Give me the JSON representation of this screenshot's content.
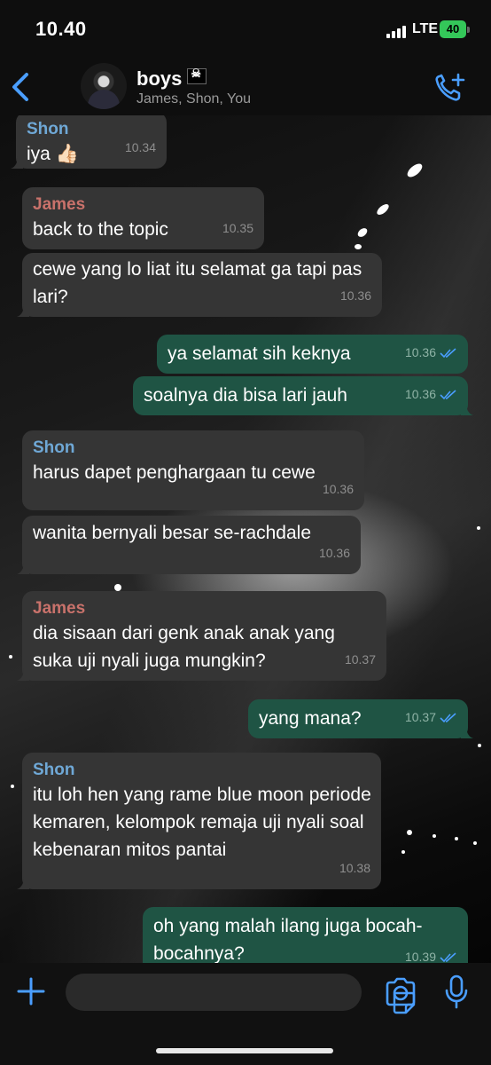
{
  "status_bar": {
    "time": "10.40",
    "network": "LTE",
    "battery": "40"
  },
  "header": {
    "back_icon": "chevron-left-icon",
    "title": "boys",
    "title_emoji": "pirate-flag",
    "subtitle": "James, Shon, You",
    "action_icon": "add-call-icon"
  },
  "colors": {
    "accent": "#4a9eff",
    "incoming": "#353535",
    "outgoing": "#1f5444",
    "shon": "#6fa8d6",
    "james": "#c9726b"
  },
  "messages": [
    {
      "sender": "Shon",
      "text": "iya 👍🏻",
      "time": "10.34",
      "direction": "in"
    },
    {
      "sender": "James",
      "text": "back to the topic",
      "time": "10.35",
      "direction": "in"
    },
    {
      "sender": "",
      "text": "cewe yang lo liat itu selamat ga tapi pas lari?",
      "time": "10.36",
      "direction": "in"
    },
    {
      "sender": "",
      "text": "ya selamat sih keknya",
      "time": "10.36",
      "direction": "out",
      "read": true
    },
    {
      "sender": "",
      "text": "soalnya dia bisa lari jauh",
      "time": "10.36",
      "direction": "out",
      "read": true
    },
    {
      "sender": "Shon",
      "text": "harus dapet penghargaan tu cewe",
      "time": "10.36",
      "direction": "in"
    },
    {
      "sender": "",
      "text": "wanita bernyali besar se-rachdale",
      "time": "10.36",
      "direction": "in"
    },
    {
      "sender": "James",
      "text": "dia sisaan dari genk anak anak yang suka uji nyali juga mungkin?",
      "time": "10.37",
      "direction": "in"
    },
    {
      "sender": "",
      "text": "yang mana?",
      "time": "10.37",
      "direction": "out",
      "read": true
    },
    {
      "sender": "Shon",
      "text": "itu loh hen yang rame blue moon periode kemaren, kelompok remaja uji nyali soal kebenaran mitos pantai",
      "time": "10.38",
      "direction": "in"
    },
    {
      "sender": "",
      "text": "oh yang malah ilang juga bocah-bocahnya?",
      "time": "10.39",
      "direction": "out",
      "read": true
    }
  ],
  "input": {
    "placeholder": "",
    "attach_icon": "plus-icon",
    "sticker_icon": "sticker-icon",
    "camera_icon": "camera-icon",
    "mic_icon": "microphone-icon"
  }
}
